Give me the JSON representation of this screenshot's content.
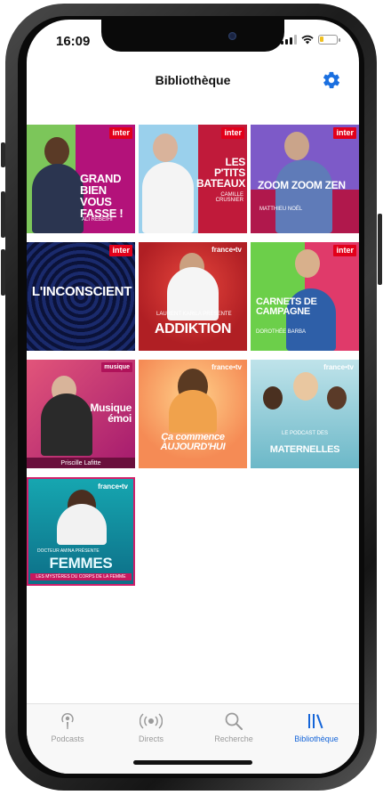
{
  "status": {
    "time": "16:09"
  },
  "header": {
    "title": "Bibliothèque",
    "settings_icon": "gear-icon"
  },
  "accent": "#1a6fe0",
  "podcasts": [
    {
      "id": "gbvf",
      "title": "GRAND BIEN VOUS FASSE !",
      "host": "ALI REBEIHI",
      "badge": "inter"
    },
    {
      "id": "lptb",
      "title": "LES P'TITS BATEAUX",
      "host": "CAMILLE CRUSNIER",
      "badge": "inter"
    },
    {
      "id": "zzz",
      "title": "ZOOM ZOOM ZEN",
      "host": "MATTHIEU NOËL",
      "badge": "inter"
    },
    {
      "id": "linc",
      "title": "L'INCONSCIENT",
      "host": "",
      "badge": "inter"
    },
    {
      "id": "addi",
      "title": "ADDIKTION",
      "host": "LAURENT KARILA PRÉSENTE",
      "badge": "france•tv"
    },
    {
      "id": "cdc",
      "title": "CARNETS DE CAMPAGNE",
      "host": "DOROTHÉE BARBA",
      "badge": "inter"
    },
    {
      "id": "mue",
      "title": "Musique émoi",
      "host": "Priscille Lafitte",
      "badge": "musique"
    },
    {
      "id": "cca",
      "title": "Ça commence AUJOURD'HUI",
      "host": "",
      "badge": "france•tv"
    },
    {
      "id": "mat",
      "title": "MATERNELLES",
      "host": "LE PODCAST des",
      "badge": "france•tv"
    },
    {
      "id": "fem",
      "title": "FEMMES",
      "host": "DOCTEUR AMINA PRÉSENTE",
      "tagline": "LES MYSTÈRES DU CORPS DE LA FEMME",
      "badge": "france•tv"
    }
  ],
  "tabs": [
    {
      "label": "Podcasts",
      "icon": "podcast-icon",
      "active": false
    },
    {
      "label": "Directs",
      "icon": "broadcast-icon",
      "active": false
    },
    {
      "label": "Recherche",
      "icon": "search-icon",
      "active": false
    },
    {
      "label": "Bibliothèque",
      "icon": "library-icon",
      "active": true
    }
  ]
}
